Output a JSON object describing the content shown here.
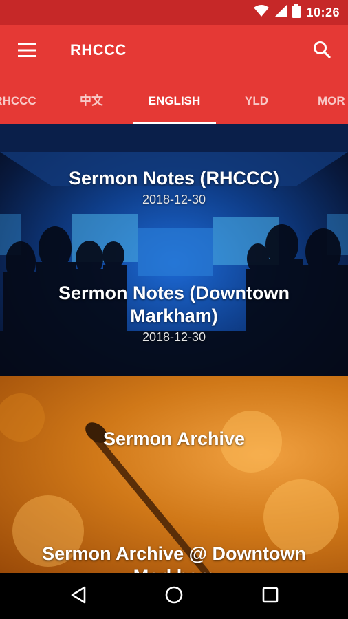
{
  "status_bar": {
    "time": "10:26"
  },
  "app_bar": {
    "title": "RHCCC"
  },
  "tabs": [
    {
      "label": "RHCCC"
    },
    {
      "label": "中文"
    },
    {
      "label": "ENGLISH"
    },
    {
      "label": "YLD"
    },
    {
      "label": "MOR"
    }
  ],
  "active_tab": "ENGLISH",
  "cards": [
    {
      "items": [
        {
          "title": "Sermon Notes (RHCCC)",
          "date": "2018-12-30"
        },
        {
          "title": "Sermon Notes (Downtown Markham)",
          "date": "2018-12-30"
        }
      ]
    },
    {
      "items": [
        {
          "title": "Sermon Archive"
        },
        {
          "title": "Sermon Archive @ Downtown Markham"
        }
      ]
    }
  ],
  "colors": {
    "app_bar": "#e53935",
    "status_bar": "#c62828"
  },
  "icons": {
    "status": [
      "wifi-icon",
      "cell-signal-icon",
      "battery-icon"
    ],
    "app_bar": [
      "menu-icon",
      "search-icon"
    ],
    "nav": [
      "back-icon",
      "home-icon",
      "recents-icon"
    ]
  }
}
